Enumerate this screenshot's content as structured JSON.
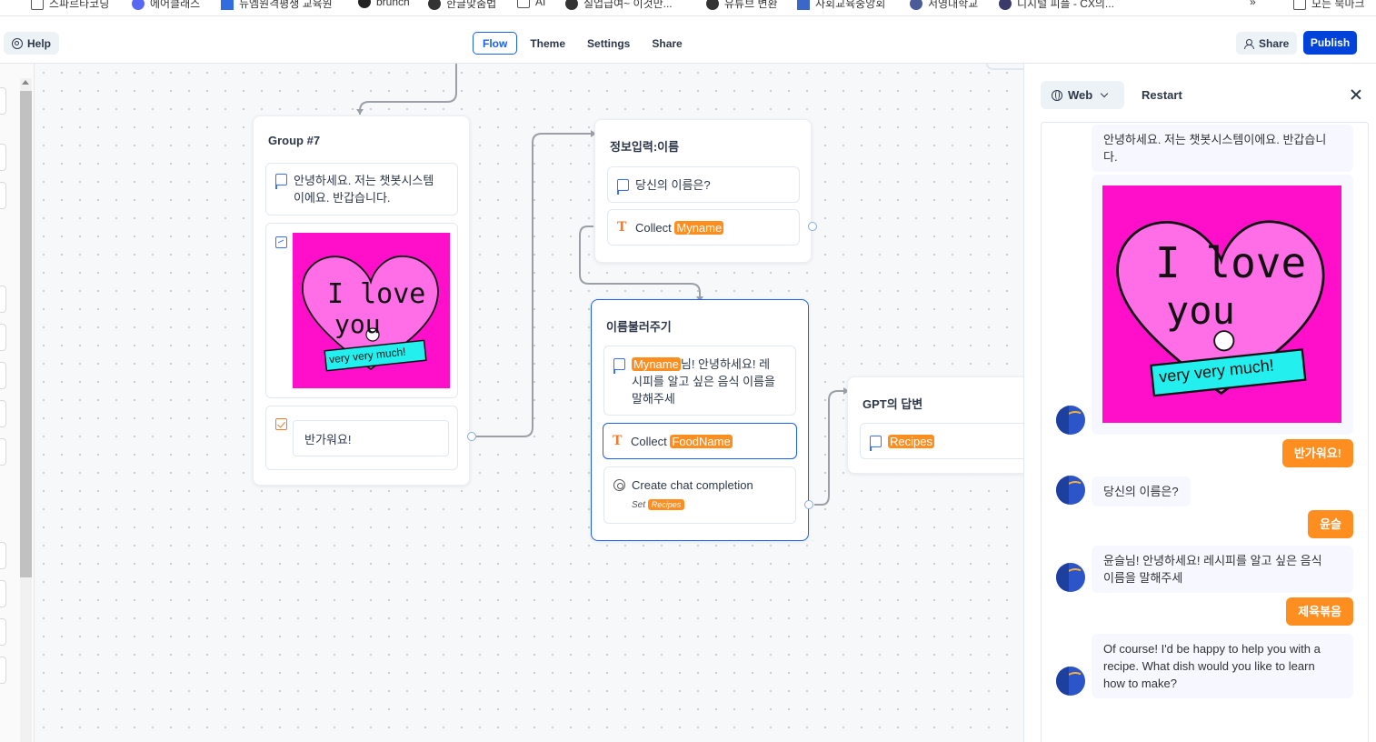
{
  "bookmarks": [
    {
      "label": "스파르타코딩"
    },
    {
      "label": "에어클래스"
    },
    {
      "label": "뉴엠원격평생 교육원"
    },
    {
      "label": "brunch"
    },
    {
      "label": "한글맞춤법"
    },
    {
      "label": "AI"
    },
    {
      "label": "실업급여~ 이것만..."
    },
    {
      "label": "유튜브 변환"
    },
    {
      "label": "사회교육중앙회"
    },
    {
      "label": "서영대학교"
    },
    {
      "label": "디지털 피플 - CX의..."
    },
    {
      "label": "»"
    },
    {
      "label": "모든 북마크"
    }
  ],
  "topbar": {
    "help_label": "Help",
    "tabs": [
      "Flow",
      "Theme",
      "Settings",
      "Share"
    ],
    "active_tab": "Flow",
    "share_label": "Share",
    "publish_label": "Publish",
    "accent_color": "#0042da"
  },
  "canvas": {
    "group7": {
      "title": "Group #7",
      "text_block": "안녕하세요. 저는 챗봇시스템 이에요. 반갑습니다.",
      "text_line1": "안녕하세요. 저는 챗봇시스템",
      "text_line2": "이에요. 반갑습니다.",
      "image_text_1": "I love",
      "image_text_2": "you",
      "image_banner": "very very much!",
      "button_value": "반가워요!"
    },
    "info_group": {
      "title": "정보입력:이름",
      "question": "당신의 이름은?",
      "collect_label": "Collect",
      "collect_var": "Myname"
    },
    "call_name_group": {
      "title": "이름불러주기",
      "msg_var": "Myname",
      "msg_line1_rest": "님! 안녕하세요! 레",
      "msg_line2": "시피를 알고 싶은 음식 이름을",
      "msg_line3": "말해주세",
      "collect_label": "Collect",
      "collect_var": "FoodName",
      "ai_label": "Create chat completion",
      "set_label": "Set",
      "set_var": "Recipes"
    },
    "gpt_group": {
      "title": "GPT의 답변",
      "var": "Recipes"
    },
    "var_color": "#ff8e21"
  },
  "preview": {
    "platform": "Web",
    "restart_label": "Restart",
    "messages": [
      {
        "from": "bot",
        "line1": "안녕하세요. 저는 챗봇시스템이에요. 반갑습니",
        "line2": "다."
      },
      {
        "from": "bot_image",
        "text1": "I love",
        "text2": "you",
        "banner": "very very much!"
      },
      {
        "from": "user",
        "text": "반가워요!"
      },
      {
        "from": "bot",
        "line1": "당신의 이름은?"
      },
      {
        "from": "user",
        "text": "윤슬"
      },
      {
        "from": "bot",
        "line1": "윤슬님! 안녕하세요! 레시피를 알고 싶은 음식",
        "line2": "이름을 말해주세"
      },
      {
        "from": "user",
        "text": "제육볶음"
      },
      {
        "from": "bot",
        "line1": "Of course! I'd be happy to help you with a",
        "line2": "recipe. What dish would you like to learn",
        "line3": "how to make?"
      }
    ]
  }
}
